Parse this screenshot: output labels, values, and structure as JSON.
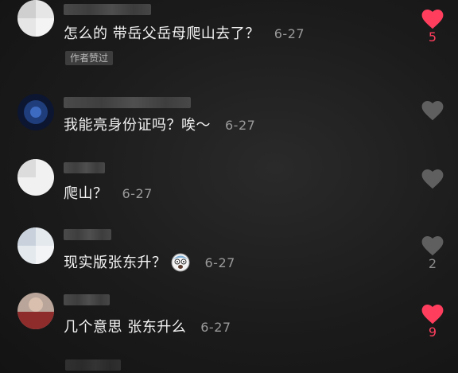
{
  "colors": {
    "liked": "#ff3e5e",
    "unliked": "#5f5f5f",
    "text": "#f2f2f2",
    "date": "#9a9a9a"
  },
  "comments": [
    {
      "text": "怎么的 带岳父岳母爬山去了？",
      "date": "6-27",
      "badge": "作者赞过",
      "liked": true,
      "like_count": "5"
    },
    {
      "text": "我能亮身份证吗？唉～",
      "date": "6-27",
      "liked": false,
      "like_count": ""
    },
    {
      "text": "爬山？",
      "date": "6-27",
      "liked": false,
      "like_count": ""
    },
    {
      "text": "现实版张东升？",
      "date": "6-27",
      "emoji": "scared-face-icon",
      "liked": false,
      "like_count": "2"
    },
    {
      "text": "几个意思 张东升么",
      "date": "6-27",
      "liked": true,
      "like_count": "9"
    }
  ]
}
